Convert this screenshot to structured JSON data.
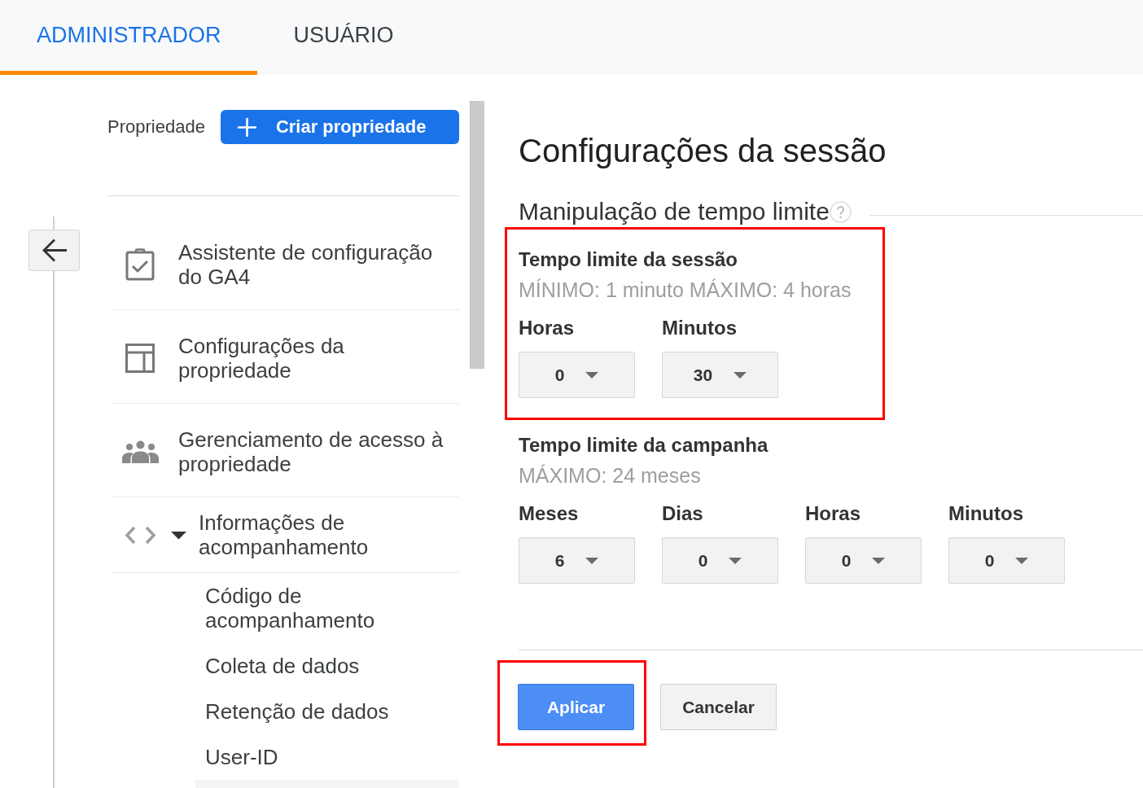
{
  "tabs": [
    {
      "label": "ADMINISTRADOR",
      "selected": true
    },
    {
      "label": "USUÁRIO",
      "selected": false
    }
  ],
  "sidebar": {
    "section_label": "Propriedade",
    "create_button": "Criar propriedade",
    "items": [
      {
        "kind": "setup_assistant",
        "label": "Assistente de configuração do GA4"
      },
      {
        "kind": "property_settings",
        "label": "Configurações da propriedade"
      },
      {
        "kind": "access_management",
        "label": "Gerenciamento de acesso à propriedade"
      },
      {
        "kind": "tracking_info",
        "label": "Informações de acompanhamento",
        "expanded": true,
        "children": [
          {
            "label": "Código de acompanhamento",
            "selected": false
          },
          {
            "label": "Coleta de dados",
            "selected": false
          },
          {
            "label": "Retenção de dados",
            "selected": false
          },
          {
            "label": "User-ID",
            "selected": false
          },
          {
            "selected": true
          }
        ]
      }
    ]
  },
  "content": {
    "title": "Configurações da sessão",
    "section_heading": "Manipulação de tempo limite",
    "session_timeout": {
      "title": "Tempo limite da sessão",
      "hint": "MÍNIMO: 1 minuto MÁXIMO: 4 horas",
      "highlighted": true,
      "fields": [
        {
          "label": "Horas",
          "value": "0"
        },
        {
          "label": "Minutos",
          "value": "30"
        }
      ]
    },
    "campaign_timeout": {
      "title": "Tempo limite da campanha",
      "hint": "MÁXIMO: 24 meses",
      "fields": [
        {
          "label": "Meses",
          "value": "6"
        },
        {
          "label": "Dias",
          "value": "0"
        },
        {
          "label": "Horas",
          "value": "0"
        },
        {
          "label": "Minutos",
          "value": "0"
        }
      ]
    },
    "buttons": [
      {
        "kind": "primary",
        "label": "Aplicar",
        "highlighted": true
      },
      {
        "kind": "secondary",
        "label": "Cancelar",
        "highlighted": false
      }
    ]
  }
}
